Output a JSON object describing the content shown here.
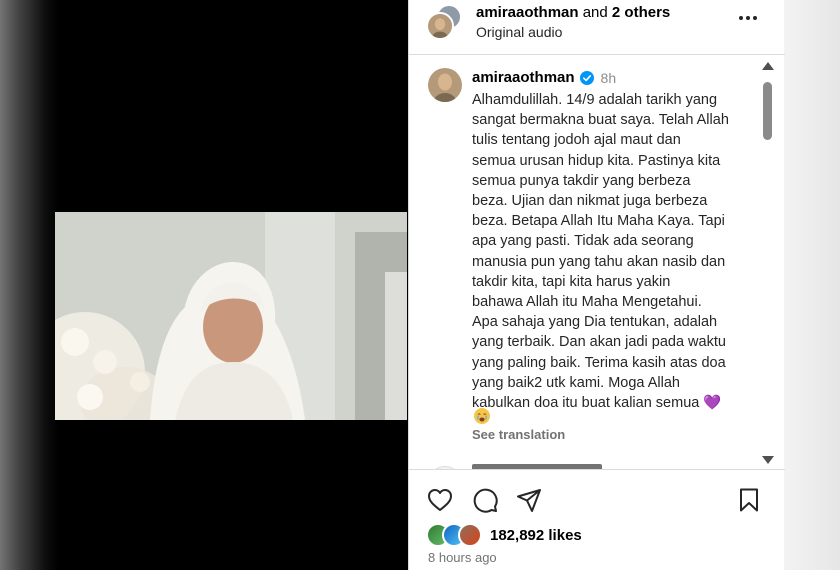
{
  "header": {
    "username": "amiraaothman",
    "and_text": "and",
    "others": "2 others",
    "audio": "Original audio"
  },
  "caption": {
    "username": "amiraaothman",
    "time": "8h",
    "lines": [
      "Alhamdulillah. 14/9 adalah tarikh yang",
      "sangat bermakna buat saya. Telah Allah",
      "tulis tentang jodoh ajal maut dan",
      "semua urusan hidup kita. Pastinya kita",
      "semua punya takdir yang berbeza",
      "beza. Ujian dan nikmat juga berbeza",
      "beza. Betapa Allah Itu Maha Kaya. Tapi",
      "apa yang pasti. Tidak ada seorang",
      "manusia pun yang tahu akan nasib dan",
      "takdir kita, tapi kita harus yakin",
      "bahawa Allah itu Maha Mengetahui.",
      "Apa sahaja yang Dia tentukan, adalah",
      "yang terbaik. Dan akan jadi pada waktu",
      "yang paling baik. Terima kasih atas doa",
      "yang baik2 utk kami. Moga Allah",
      "kabulkan doa itu buat kalian semua 💜"
    ],
    "see_translation": "See translation"
  },
  "likes": {
    "count_text": "182,892 likes"
  },
  "post_time": "8 hours ago",
  "colors": {
    "verified": "#0095f6",
    "secondary_text": "#737373",
    "border": "#dbdbdb"
  },
  "icons": {
    "more": "more-options-icon",
    "verified": "verified-badge-icon",
    "like": "heart-icon",
    "comment": "comment-icon",
    "share": "share-icon",
    "save": "bookmark-icon"
  }
}
